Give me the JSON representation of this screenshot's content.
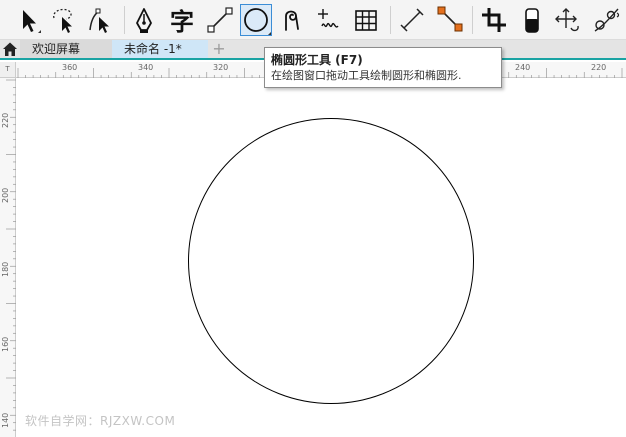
{
  "tabs": {
    "welcome_label": "欢迎屏幕",
    "document_label": "未命名 -1*",
    "add_label": "+"
  },
  "toolbar": {
    "tools": [
      {
        "name": "pick-tool",
        "icon": "arrow-cursor-icon"
      },
      {
        "name": "freehand-pick-tool",
        "icon": "lasso-arrow-icon"
      },
      {
        "name": "shape-tool",
        "icon": "shape-edit-icon"
      },
      {
        "name": "artistic-media-tool",
        "icon": "pen-nib-icon"
      },
      {
        "name": "text-tool",
        "icon": "text-character-icon"
      },
      {
        "name": "line-tool",
        "icon": "line-icon"
      },
      {
        "name": "ellipse-tool",
        "icon": "ellipse-icon"
      },
      {
        "name": "spiral-tool",
        "icon": "spiral-icon"
      },
      {
        "name": "freehand-tool",
        "icon": "squiggle-icon"
      },
      {
        "name": "table-tool",
        "icon": "table-icon"
      },
      {
        "name": "dimension-tool",
        "icon": "dimension-line-icon"
      },
      {
        "name": "connector-tool",
        "icon": "connector-icon"
      },
      {
        "name": "crop-tool",
        "icon": "crop-icon"
      },
      {
        "name": "eraser-tool",
        "icon": "eraser-icon"
      },
      {
        "name": "pan-tool",
        "icon": "pan-move-icon"
      },
      {
        "name": "blend-tool",
        "icon": "blend-icon"
      }
    ],
    "active_tool": "ellipse-tool"
  },
  "tooltip": {
    "title": "椭圆形工具 (F7)",
    "description": "在绘图窗口拖动工具绘制圆形和椭圆形."
  },
  "rulers": {
    "corner_label": "T",
    "horizontal": [
      "360",
      "340",
      "320",
      "240",
      "220"
    ],
    "vertical": [
      "220",
      "200",
      "180",
      "160",
      "140"
    ]
  },
  "watermark": "软件自学网：RJZXW.COM",
  "colors": {
    "accent_teal": "#19a3a3",
    "active_tool_border": "#3b8dd6",
    "connector_orange": "#e4701e"
  }
}
